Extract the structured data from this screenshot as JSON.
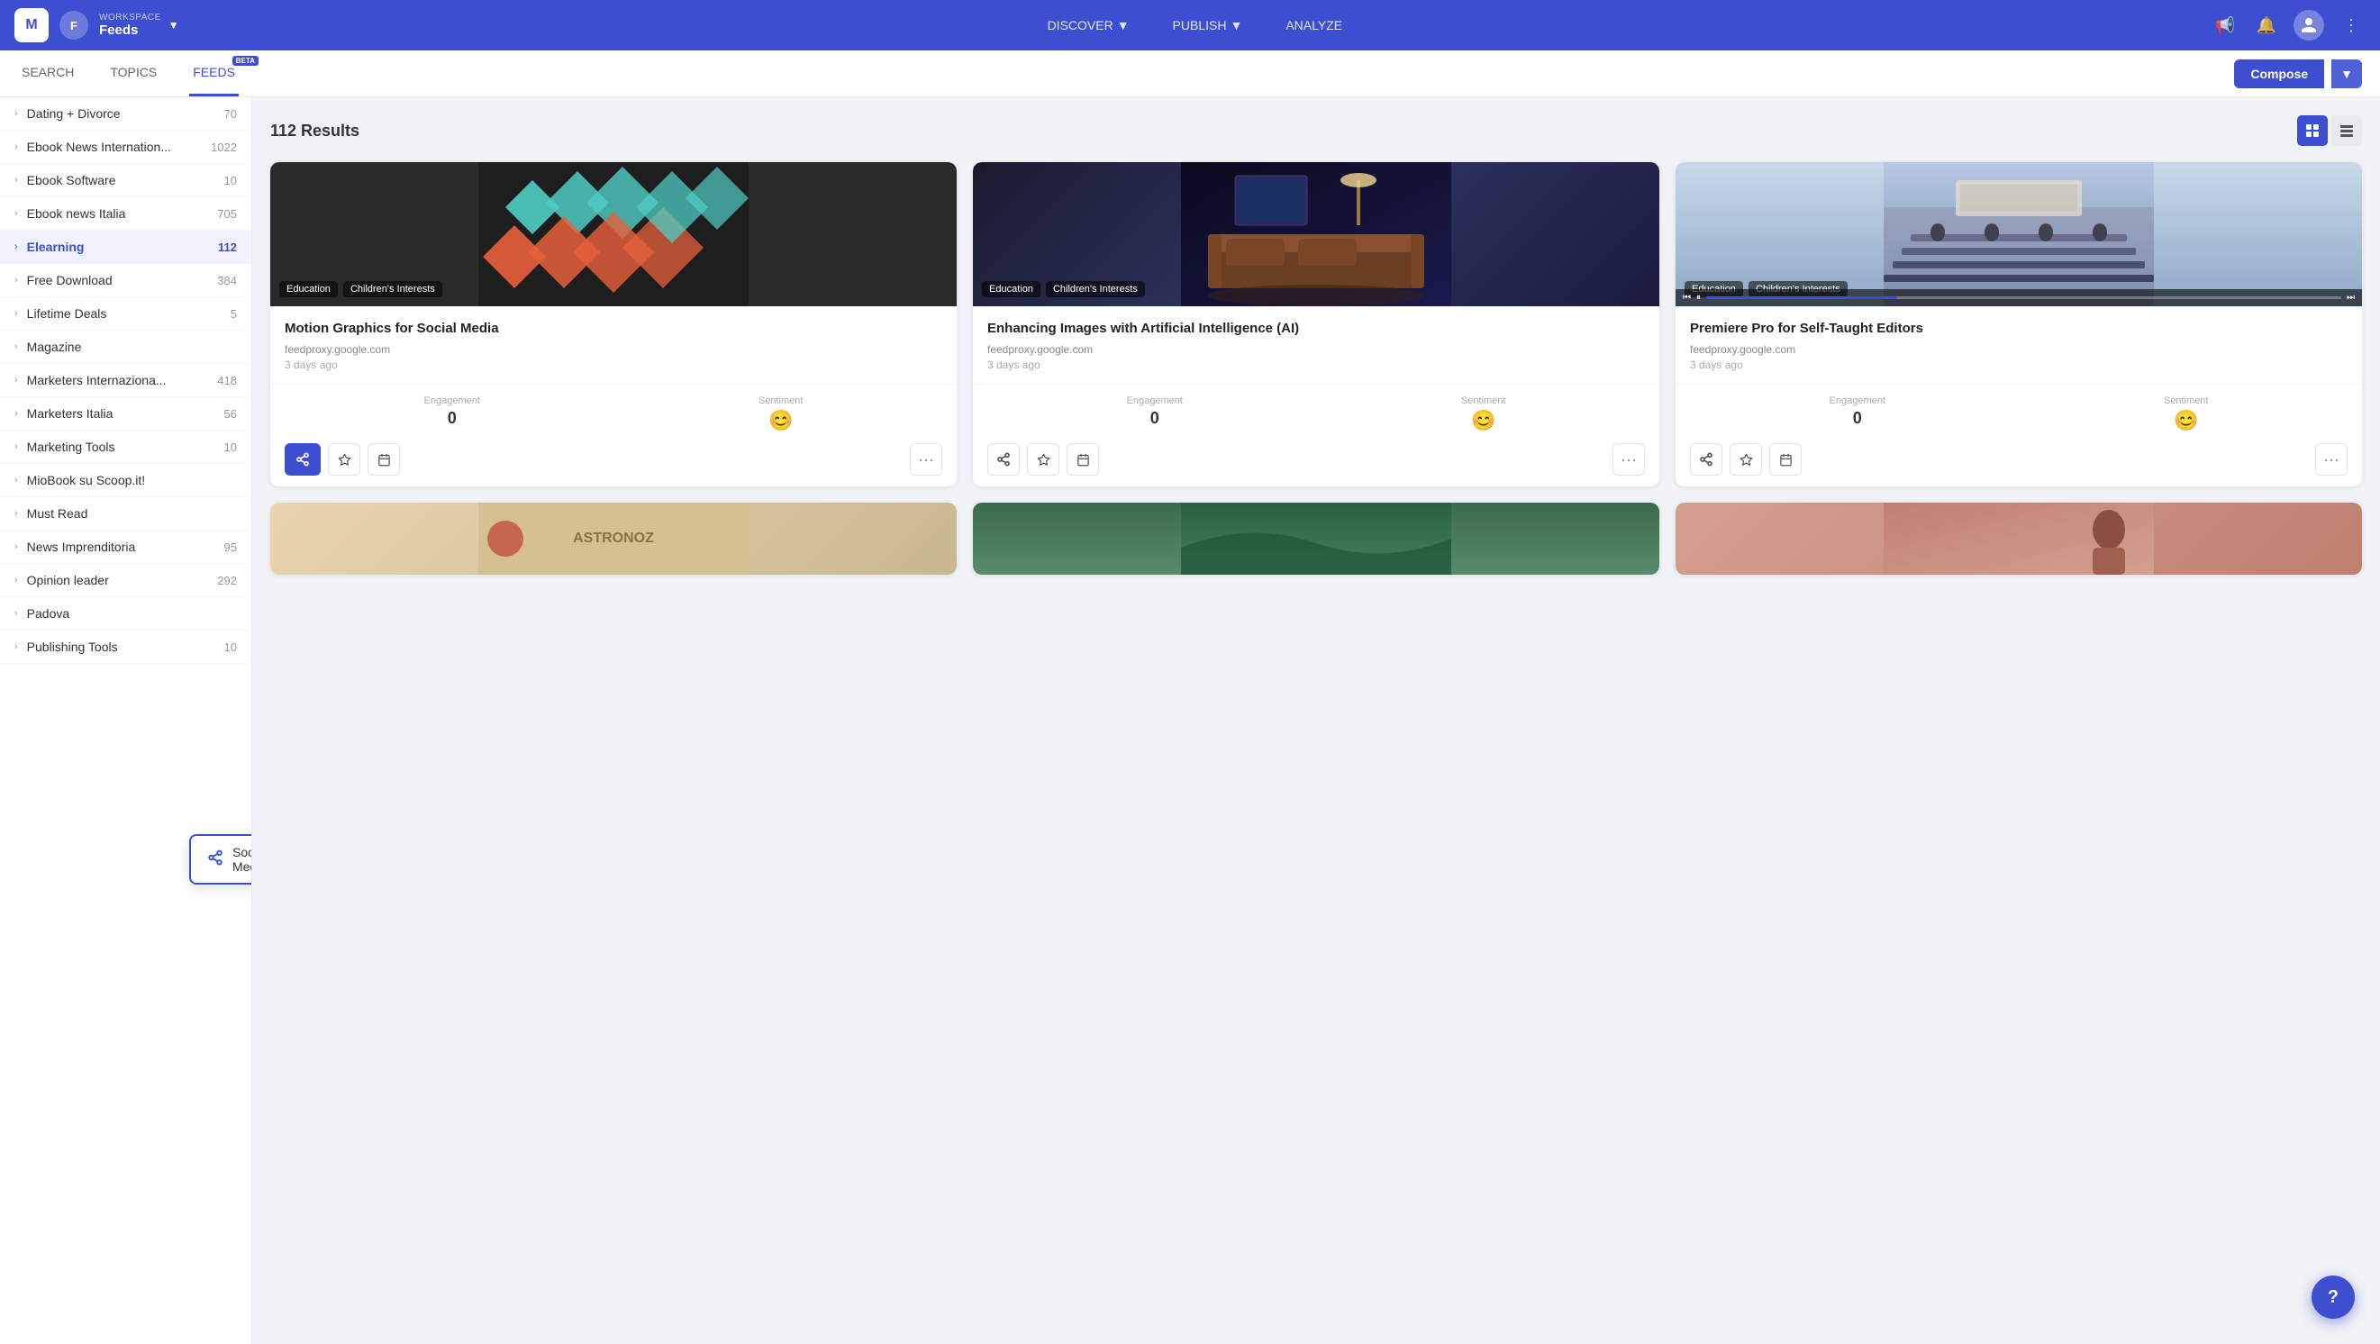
{
  "topnav": {
    "logo_text": "M",
    "workspace_label": "WORKSPACE",
    "workspace_name": "Feeds",
    "nav_items": [
      {
        "label": "DISCOVER",
        "has_chevron": true
      },
      {
        "label": "PUBLISH",
        "has_chevron": true
      },
      {
        "label": "ANALYZE",
        "has_chevron": false
      }
    ]
  },
  "subnav": {
    "tabs": [
      {
        "label": "SEARCH",
        "active": false
      },
      {
        "label": "TOPICS",
        "active": false
      },
      {
        "label": "FEEDS",
        "active": true,
        "has_beta": true
      }
    ],
    "compose_label": "Compose"
  },
  "sidebar": {
    "items": [
      {
        "name": "Dating + Divorce",
        "count": "70",
        "active": false
      },
      {
        "name": "Ebook News Internation...",
        "count": "1022",
        "active": false
      },
      {
        "name": "Ebook Software",
        "count": "10",
        "active": false
      },
      {
        "name": "Ebook news Italia",
        "count": "705",
        "active": false
      },
      {
        "name": "Elearning",
        "count": "112",
        "active": true
      },
      {
        "name": "Free Download",
        "count": "384",
        "active": false
      },
      {
        "name": "Lifetime Deals",
        "count": "5",
        "active": false
      },
      {
        "name": "Magazine",
        "count": "",
        "active": false
      },
      {
        "name": "Marketers Internaziona...",
        "count": "418",
        "active": false
      },
      {
        "name": "Marketers Italia",
        "count": "56",
        "active": false
      },
      {
        "name": "Marketing Tools",
        "count": "10",
        "active": false
      },
      {
        "name": "MioBook su Scoop.it!",
        "count": "",
        "active": false
      },
      {
        "name": "Must Read",
        "count": "",
        "active": false
      },
      {
        "name": "News Imprenditoria",
        "count": "95",
        "active": false
      },
      {
        "name": "Opinion leader",
        "count": "292",
        "active": false
      },
      {
        "name": "Padova",
        "count": "",
        "active": false
      },
      {
        "name": "Publishing Tools",
        "count": "10",
        "active": false
      }
    ],
    "tooltip": {
      "text": "Social Media"
    }
  },
  "content": {
    "results_count": "112 Results",
    "cards": [
      {
        "title": "Motion Graphics for Social Media",
        "source": "feedproxy.google.com",
        "time": "3 days ago",
        "tags": [
          "Education",
          "Children's Interests"
        ],
        "engagement": "0",
        "sentiment_positive": true
      },
      {
        "title": "Enhancing Images with Artificial Intelligence (AI)",
        "source": "feedproxy.google.com",
        "time": "3 days ago",
        "tags": [
          "Education",
          "Children's Interests"
        ],
        "engagement": "0",
        "sentiment_positive": true
      },
      {
        "title": "Premiere Pro for Self-Taught Editors",
        "source": "feedproxy.google.com",
        "time": "3 days ago",
        "tags": [
          "Education",
          "Children's Interests"
        ],
        "engagement": "0",
        "sentiment_positive": true,
        "has_video_controls": true
      }
    ],
    "labels": {
      "engagement": "Engagement",
      "sentiment": "Sentiment"
    }
  }
}
